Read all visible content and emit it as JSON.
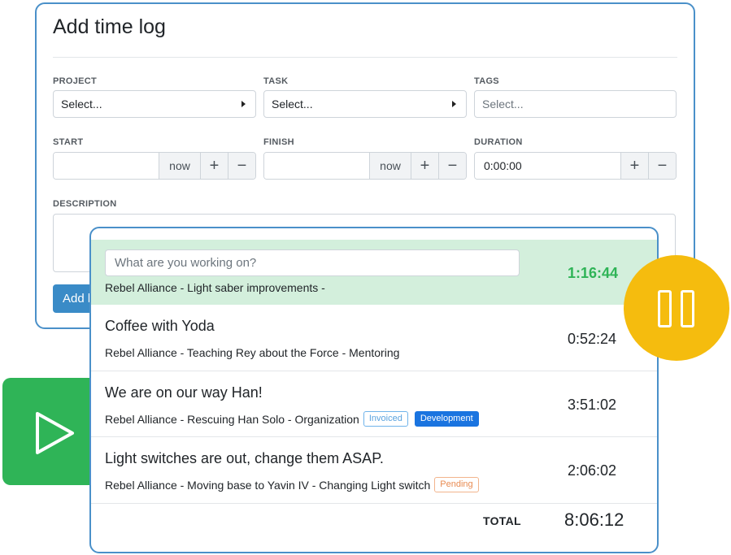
{
  "form": {
    "title": "Add time log",
    "project": {
      "label": "PROJECT",
      "placeholder": "Select..."
    },
    "task": {
      "label": "TASK",
      "placeholder": "Select..."
    },
    "tags": {
      "label": "TAGS",
      "placeholder": "Select..."
    },
    "start": {
      "label": "START",
      "value": "",
      "now": "now",
      "plus": "+",
      "minus": "−"
    },
    "finish": {
      "label": "FINISH",
      "value": "",
      "now": "now",
      "plus": "+",
      "minus": "−"
    },
    "duration": {
      "label": "DURATION",
      "value": "0:00:00",
      "plus": "+",
      "minus": "−"
    },
    "description": {
      "label": "DESCRIPTION",
      "value": ""
    },
    "add_label": "Add l"
  },
  "tracker": {
    "running": {
      "placeholder": "What are you working on?",
      "subtitle": "Rebel Alliance - Light saber improvements -",
      "time": "1:16:44"
    },
    "entries": [
      {
        "title": "Coffee with Yoda",
        "subtitle": "Rebel Alliance - Teaching Rey about the Force - Mentoring",
        "time": "0:52:24",
        "badges": []
      },
      {
        "title": "We are on our way Han!",
        "subtitle": "Rebel Alliance - Rescuing Han Solo - Organization",
        "time": "3:51:02",
        "badges": [
          "Invoiced",
          "Development"
        ]
      },
      {
        "title": "Light switches are out, change them ASAP.",
        "subtitle": "Rebel Alliance - Moving base to Yavin IV - Changing Light switch",
        "time": "2:06:02",
        "badges": [
          "Pending"
        ]
      }
    ],
    "total_label": "TOTAL",
    "total_value": "8:06:12"
  },
  "icons": {
    "play": "play-icon",
    "pause": "pause-icon"
  },
  "colors": {
    "accent": "#4a90c9",
    "running_bg": "#d3efdc",
    "running_time": "#2fb457",
    "play_tile": "#2fb457",
    "pause_circle": "#f5bc0e",
    "invoiced": "#5aa3df",
    "development": "#1a74e0",
    "pending": "#e88b52"
  }
}
